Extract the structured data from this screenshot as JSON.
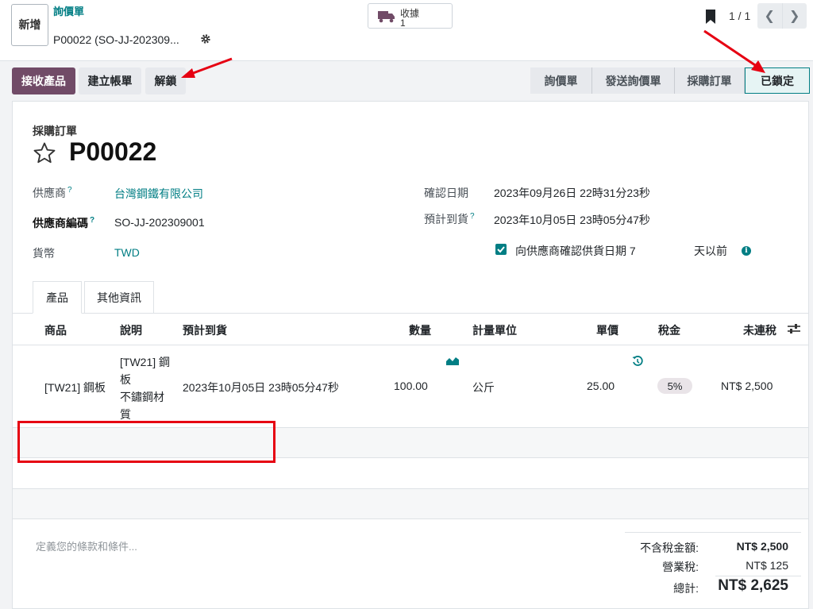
{
  "header": {
    "new_button": "新增",
    "breadcrumb_parent": "詢價單",
    "breadcrumb_current": "P00022 (SO-JJ-202309...",
    "receipt_label": "收據",
    "receipt_count": "1",
    "pager_value": "1 / 1"
  },
  "actions": {
    "receive_products": "接收產品",
    "create_bill": "建立帳單",
    "unlock": "解鎖"
  },
  "status_stages": [
    {
      "label": "詢價單",
      "active": false
    },
    {
      "label": "發送詢價單",
      "active": false
    },
    {
      "label": "採購訂單",
      "active": false
    },
    {
      "label": "已鎖定",
      "active": true
    }
  ],
  "form": {
    "doc_type": "採購訂單",
    "name": "P00022",
    "vendor_label": "供應商",
    "vendor_value": "台灣鋼鐵有限公司",
    "vendor_ref_label": "供應商編碼",
    "vendor_ref_value": "SO-JJ-202309001",
    "currency_label": "貨幣",
    "currency_value": "TWD",
    "confirm_date_label": "確認日期",
    "confirm_date_value": "2023年09月26日 22時31分23秒",
    "expected_arrival_label": "預計到貨",
    "expected_arrival_value": "2023年10月05日 23時05分47秒",
    "reminder_label": "向供應商確認供貨日期",
    "reminder_days": "7",
    "reminder_suffix": "天以前",
    "help_mark": "?"
  },
  "tabs": [
    {
      "label": "產品",
      "active": true
    },
    {
      "label": "其他資訊",
      "active": false
    }
  ],
  "table": {
    "headers": {
      "product": "商品",
      "description": "說明",
      "expected": "預計到貨",
      "qty": "數量",
      "uom": "計量單位",
      "price": "單價",
      "tax": "稅金",
      "subtotal": "未連稅"
    },
    "rows": [
      {
        "product": "[TW21] 鋼板",
        "description_lines": [
          "[TW21] 鋼",
          "板",
          "不鏽鋼材",
          "質"
        ],
        "expected": "2023年10月05日 23時05分47秒",
        "qty": "100.00",
        "uom": "公斤",
        "price": "25.00",
        "tax": "5%",
        "subtotal": "NT$ 2,500"
      }
    ]
  },
  "terms_placeholder": "定義您的條款和條件...",
  "totals": {
    "untaxed_label": "不含稅金額:",
    "untaxed_value": "NT$ 2,500",
    "tax_label": "營業稅:",
    "tax_value": "NT$ 125",
    "total_label": "總計:",
    "total_value": "NT$ 2,625"
  },
  "colors": {
    "primary": "#714b67",
    "teal": "#017e84",
    "annotation_red": "#e60012"
  },
  "icons": [
    "gear-icon",
    "truck-icon",
    "bookmark-icon",
    "chevron-left-icon",
    "chevron-right-icon",
    "star-icon",
    "checkbox-icon",
    "info-icon",
    "chart-icon",
    "history-icon",
    "sliders-icon"
  ]
}
